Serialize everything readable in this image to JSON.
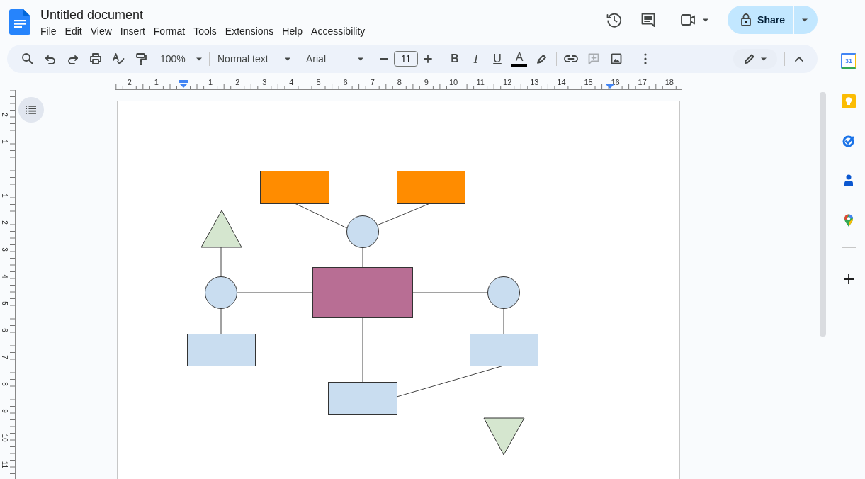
{
  "document": {
    "title": "Untitled document"
  },
  "menu": [
    {
      "label": "File"
    },
    {
      "label": "Edit"
    },
    {
      "label": "View"
    },
    {
      "label": "Insert"
    },
    {
      "label": "Format"
    },
    {
      "label": "Tools"
    },
    {
      "label": "Extensions"
    },
    {
      "label": "Help"
    },
    {
      "label": "Accessibility"
    }
  ],
  "share": {
    "label": "Share"
  },
  "toolbar": {
    "zoom": "100%",
    "style": "Normal text",
    "font": "Arial",
    "font_size": "11",
    "format": [
      {
        "label": "B"
      },
      {
        "label": "I"
      },
      {
        "label": "U"
      },
      {
        "label": "A"
      }
    ],
    "add_comment": {
      "disabled": true
    }
  },
  "ruler": {
    "labels": [
      "2",
      "1",
      "1",
      "2",
      "3",
      "4",
      "5",
      "6",
      "7",
      "8",
      "9",
      "10",
      "11",
      "12",
      "13",
      "14",
      "15",
      "16",
      "17",
      "18"
    ]
  },
  "vertical_ruler": {
    "labels": [
      "2",
      "1",
      "1",
      "2",
      "3",
      "4",
      "5",
      "6",
      "7",
      "8",
      "9",
      "10",
      "11"
    ]
  },
  "side_panel": {
    "calendar_day": "31"
  }
}
